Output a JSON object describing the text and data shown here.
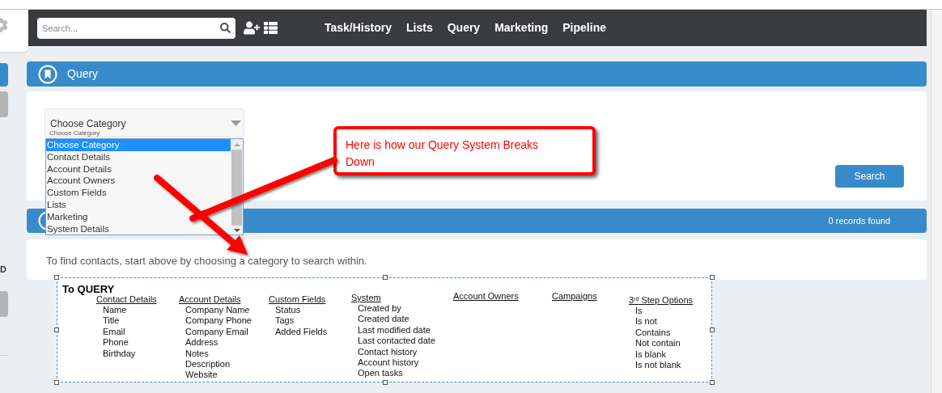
{
  "nav": {
    "search_placeholder": "Search...",
    "links": [
      {
        "label": "Task/History"
      },
      {
        "label": "Lists"
      },
      {
        "label": "Query"
      },
      {
        "label": "Marketing"
      },
      {
        "label": "Pipeline"
      }
    ]
  },
  "sidebar": {
    "letter": "D",
    "tabs": [
      {
        "selected": true
      },
      {
        "selected": false
      },
      {
        "selected": false
      }
    ]
  },
  "query_panel": {
    "title": "Query",
    "select": {
      "value": "Choose Category",
      "caption": "Choose Category",
      "options": [
        {
          "label": "Choose Category",
          "selected": true
        },
        {
          "label": "Contact Details",
          "selected": false
        },
        {
          "label": "Account Details",
          "selected": false
        },
        {
          "label": "Account Owners",
          "selected": false
        },
        {
          "label": "Custom Fields",
          "selected": false
        },
        {
          "label": "Lists",
          "selected": false
        },
        {
          "label": "Marketing",
          "selected": false
        },
        {
          "label": "System Details",
          "selected": false
        }
      ]
    },
    "search_button": "Search"
  },
  "results": {
    "count": "0 records found",
    "hint": "To find contacts, start above by choosing a category to search within."
  },
  "callout": {
    "text": "Here is how our Query System Breaks Down"
  },
  "pasted_image": {
    "title": "To QUERY",
    "columns": [
      {
        "heading": "Contact Details",
        "items": [
          "Name",
          "Title",
          "Email",
          "Phone",
          "Birthday"
        ]
      },
      {
        "heading": "Account Details",
        "items": [
          "Company Name",
          "Company Phone",
          "Company Email",
          "Address",
          "Notes",
          "Description",
          "Website"
        ]
      },
      {
        "heading": "Custom Fields",
        "items": [
          "Status",
          "Tags",
          "Added Fields"
        ]
      },
      {
        "heading": "System",
        "items": [
          "Created by",
          "Created date",
          "Last modified date",
          "Last contacted date",
          "Contact history",
          "Account history",
          "Open tasks"
        ]
      },
      {
        "heading": "Account Owners"
      },
      {
        "heading": "Campaigns"
      },
      {
        "heading": "3$^{rd}$ Step Options",
        "items": [
          "Is",
          "Is not",
          "Contains",
          "Not contain",
          "Is blank",
          "Is not blank"
        ]
      }
    ]
  }
}
